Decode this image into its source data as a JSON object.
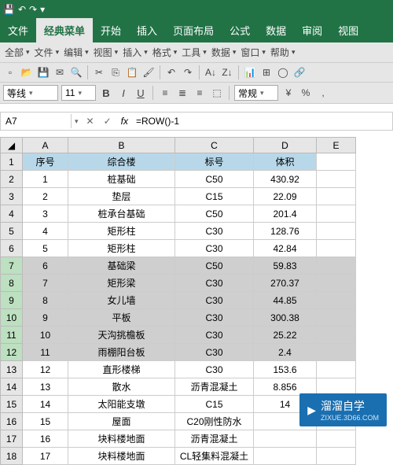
{
  "qat": {
    "save": "💾",
    "undo": "↶",
    "redo": "↷",
    "more": "▾"
  },
  "ribbon": {
    "tabs": [
      "文件",
      "经典菜单",
      "开始",
      "插入",
      "页面布局",
      "公式",
      "数据",
      "审阅",
      "视图"
    ],
    "active": 1
  },
  "menubar": [
    "全部",
    "文件",
    "编辑",
    "视图",
    "插入",
    "格式",
    "工具",
    "数据",
    "窗口",
    "帮助"
  ],
  "format": {
    "style_label": "等线",
    "font_size": "11",
    "bold": "B",
    "italic": "I",
    "underline": "U",
    "normal": "常规"
  },
  "namefx": {
    "cell_ref": "A7",
    "cancel": "✕",
    "confirm": "✓",
    "fx": "fx",
    "formula": "=ROW()-1"
  },
  "columns": [
    "A",
    "B",
    "C",
    "D",
    "E"
  ],
  "headers": {
    "A": "序号",
    "B": "综合楼",
    "C": "标号",
    "D": "体积"
  },
  "selection_start": 7,
  "selection_end": 12,
  "rows": [
    {
      "n": 2,
      "A": "1",
      "B": "桩基础",
      "C": "C50",
      "D": "430.92"
    },
    {
      "n": 3,
      "A": "2",
      "B": "垫层",
      "C": "C15",
      "D": "22.09"
    },
    {
      "n": 4,
      "A": "3",
      "B": "桩承台基础",
      "C": "C50",
      "D": "201.4"
    },
    {
      "n": 5,
      "A": "4",
      "B": "矩形柱",
      "C": "C30",
      "D": "128.76"
    },
    {
      "n": 6,
      "A": "5",
      "B": "矩形柱",
      "C": "C30",
      "D": "42.84"
    },
    {
      "n": 7,
      "A": "6",
      "B": "基础梁",
      "C": "C50",
      "D": "59.83"
    },
    {
      "n": 8,
      "A": "7",
      "B": "矩形梁",
      "C": "C30",
      "D": "270.37"
    },
    {
      "n": 9,
      "A": "8",
      "B": "女儿墙",
      "C": "C30",
      "D": "44.85"
    },
    {
      "n": 10,
      "A": "9",
      "B": "平板",
      "C": "C30",
      "D": "300.38"
    },
    {
      "n": 11,
      "A": "10",
      "B": "天沟挑檐板",
      "C": "C30",
      "D": "25.22"
    },
    {
      "n": 12,
      "A": "11",
      "B": "雨棚阳台板",
      "C": "C30",
      "D": "2.4"
    },
    {
      "n": 13,
      "A": "12",
      "B": "直形楼梯",
      "C": "C30",
      "D": "153.6"
    },
    {
      "n": 14,
      "A": "13",
      "B": "散水",
      "C": "沥青混凝土",
      "D": "8.856"
    },
    {
      "n": 15,
      "A": "14",
      "B": "太阳能支墩",
      "C": "C15",
      "D": "14"
    },
    {
      "n": 16,
      "A": "15",
      "B": "屋面",
      "C": "C20刚性防水",
      "D": ""
    },
    {
      "n": 17,
      "A": "16",
      "B": "块料楼地面",
      "C": "沥青混凝土",
      "D": ""
    },
    {
      "n": 18,
      "A": "17",
      "B": "块料楼地面",
      "C": "CL轻集料混凝土",
      "D": ""
    }
  ],
  "watermark": {
    "name": "溜溜自学",
    "url": "ZIXUE.3D66.COM"
  }
}
